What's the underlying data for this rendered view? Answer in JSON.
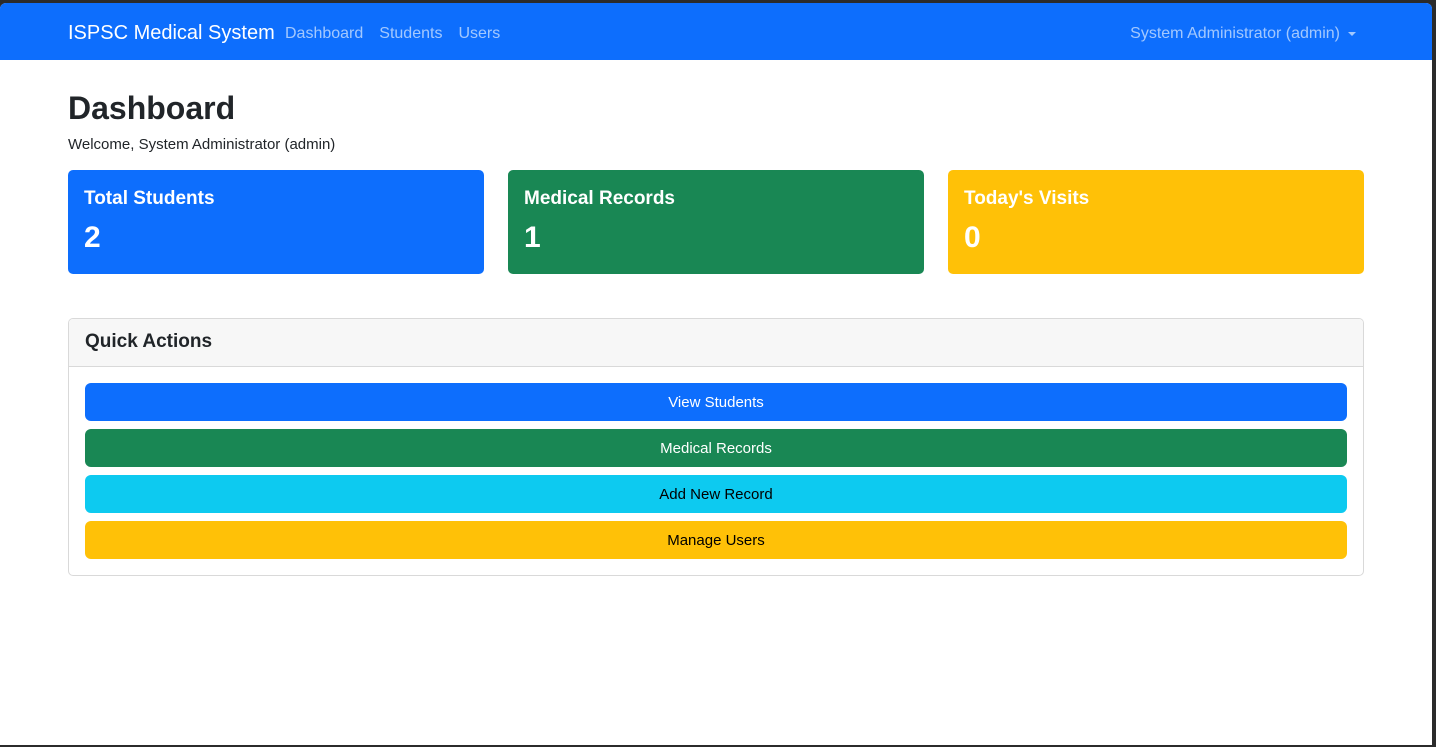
{
  "navbar": {
    "brand": "ISPSC Medical System",
    "links": [
      {
        "label": "Dashboard"
      },
      {
        "label": "Students"
      },
      {
        "label": "Users"
      }
    ],
    "user": "System Administrator (admin)"
  },
  "page": {
    "title": "Dashboard",
    "welcome": "Welcome, System Administrator (admin)"
  },
  "stats": [
    {
      "label": "Total Students",
      "value": "2",
      "color": "#0d6efd",
      "text_color": "#ffffff"
    },
    {
      "label": "Medical Records",
      "value": "1",
      "color": "#198754",
      "text_color": "#ffffff"
    },
    {
      "label": "Today's Visits",
      "value": "0",
      "color": "#ffc107",
      "text_color": "#ffffff"
    }
  ],
  "quick_actions": {
    "title": "Quick Actions",
    "buttons": [
      {
        "label": "View Students",
        "color": "#0d6efd",
        "text_color": "#ffffff"
      },
      {
        "label": "Medical Records",
        "color": "#198754",
        "text_color": "#ffffff"
      },
      {
        "label": "Add New Record",
        "color": "#0dcaf0",
        "text_color": "#000000"
      },
      {
        "label": "Manage Users",
        "color": "#ffc107",
        "text_color": "#000000"
      }
    ]
  }
}
